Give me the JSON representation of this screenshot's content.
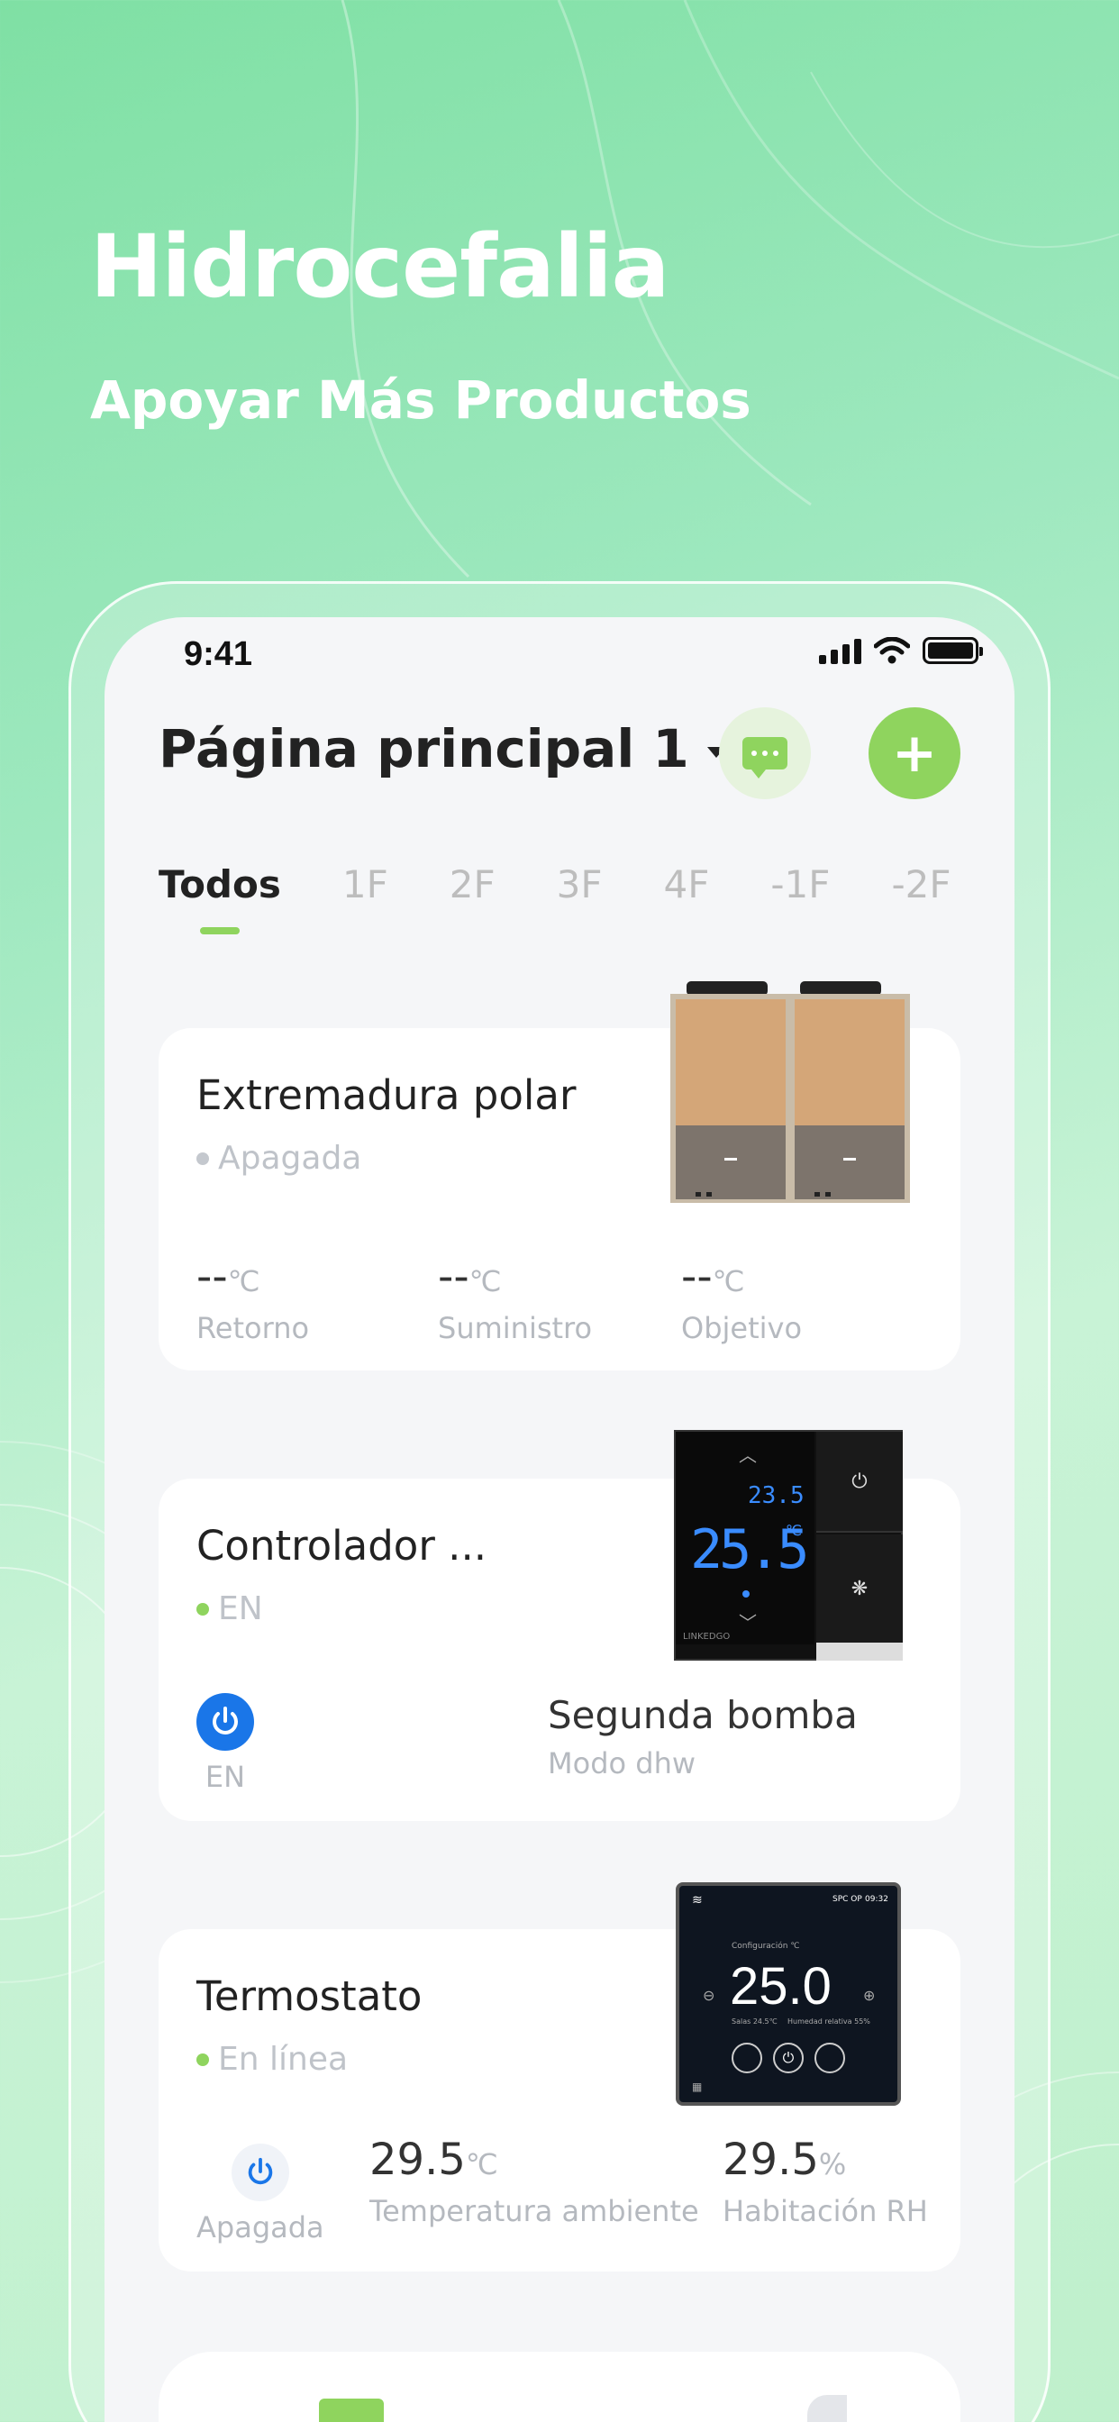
{
  "hero": {
    "title": "Hidrocefalia",
    "subtitle": "Apoyar Más Productos"
  },
  "status_bar": {
    "time": "9:41",
    "icons": [
      "signal-icon",
      "wifi-icon",
      "battery-icon"
    ]
  },
  "header": {
    "title": "Página principal 1",
    "message_icon": "chat-icon",
    "add_icon": "plus-icon"
  },
  "tabs": [
    "Todos",
    "1F",
    "2F",
    "3F",
    "4F",
    "-1F",
    "-2F"
  ],
  "active_tab": "Todos",
  "colors": {
    "accent": "#8fd45e",
    "power_blue": "#1a76e8"
  },
  "devices": [
    {
      "name": "Extremadura polar",
      "status": "Apagada",
      "status_color": "#c4c8ce",
      "metrics": [
        {
          "value": "--",
          "unit": "℃",
          "label": "Retorno"
        },
        {
          "value": "--",
          "unit": "℃",
          "label": "Suministro"
        },
        {
          "value": "--",
          "unit": "℃",
          "label": "Objetivo"
        }
      ]
    },
    {
      "name": "Controlador ...",
      "status": "EN",
      "status_color": "#8fd45e",
      "power_label": "EN",
      "mode_value": "Segunda bomba",
      "mode_label": "Modo dhw",
      "panel": {
        "set_temp": "23.5",
        "current_temp": "25.5",
        "unit": "℃",
        "brand": "LINKEDGO"
      }
    },
    {
      "name": "Termostato",
      "status": "En línea",
      "status_color": "#8fd45e",
      "power_label": "Apagada",
      "metrics": [
        {
          "value": "29.5",
          "unit": "℃",
          "label": "Temperatura ambiente"
        },
        {
          "value": "29.5",
          "unit": "%",
          "label": "Habitación RH"
        }
      ],
      "screen": {
        "temp": "25.0",
        "top_right": "SPC OP",
        "time": "09:32",
        "caption": "Configuración ℃",
        "sub_left": "Salas 24.5℃",
        "sub_right": "Humedad relativa 55%"
      }
    }
  ]
}
